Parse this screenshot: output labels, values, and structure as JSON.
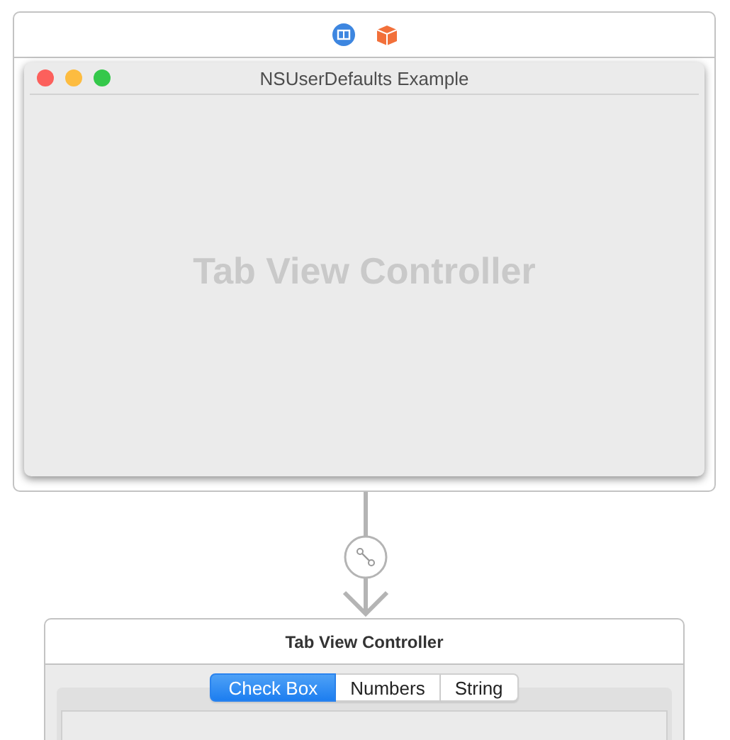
{
  "window": {
    "title": "NSUserDefaults Example",
    "content_label": "Tab View Controller"
  },
  "tab_view_scene": {
    "title": "Tab View Controller",
    "tabs": [
      {
        "label": "Check Box",
        "selected": true
      },
      {
        "label": "Numbers",
        "selected": false
      },
      {
        "label": "String",
        "selected": false
      }
    ]
  }
}
